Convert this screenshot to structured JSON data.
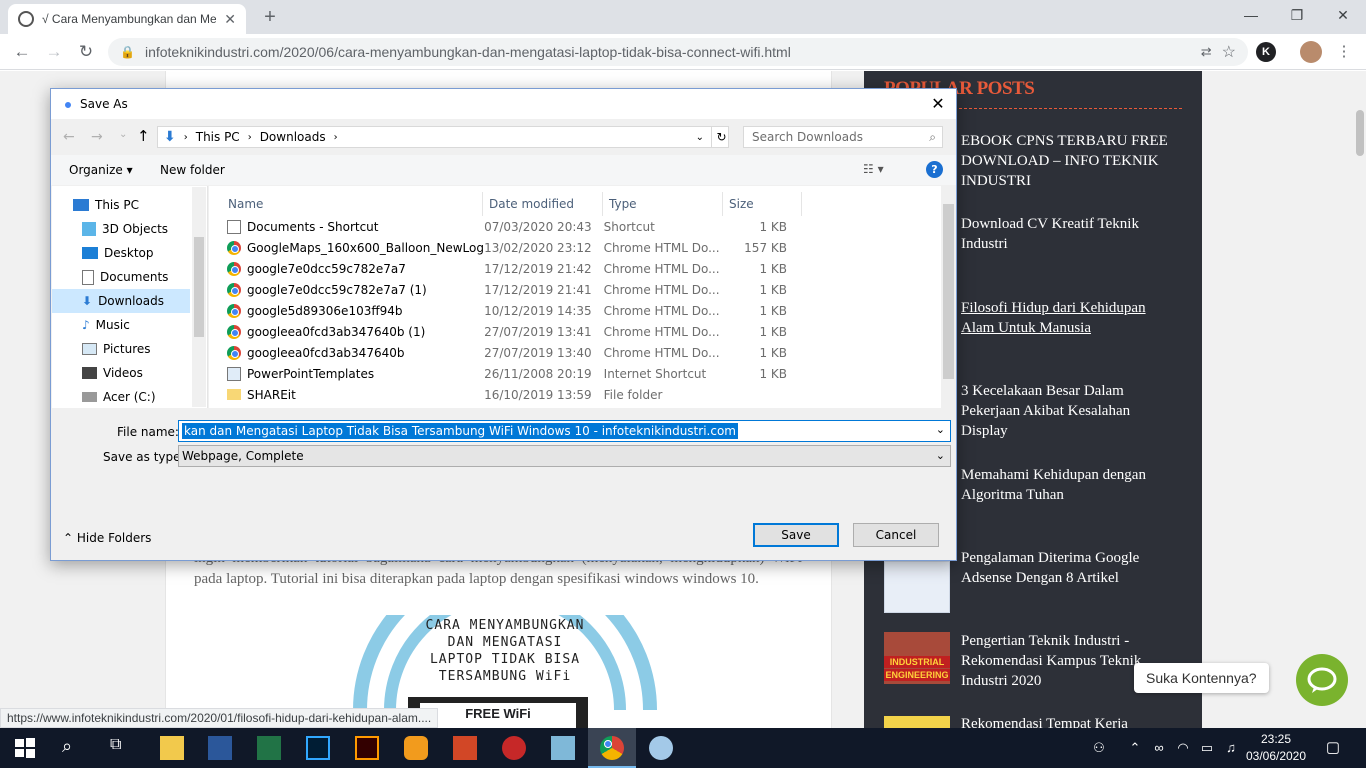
{
  "browser": {
    "tab_title": "√ Cara Menyambungkan dan Me",
    "new_tab_label": "+",
    "url": "infoteknikindustri.com/2020/06/cara-menyambungkan-dan-mengatasi-laptop-tidak-bisa-connect-wifi.html",
    "profile_initial": "K",
    "status_url": "https://www.infoteknikindustri.com/2020/01/filosofi-hidup-dari-kehidupan-alam...."
  },
  "article": {
    "text": "ingin memberikan tutorial bagaimana cara menyambungkan (menyalakan, menghidupkan) WiFi pada laptop. Tutorial ini bisa diterapkan pada laptop dengan spesifikasi windows windows 10.",
    "image_lines": [
      "CARA MENYAMBUNGKAN",
      "DAN MENGATASI",
      "LAPTOP TIDAK BISA",
      "TERSAMBUNG WiFi"
    ],
    "image_badge": "FREE WiFi"
  },
  "sidebar": {
    "title": "POPULAR POSTS",
    "posts": [
      "EBOOK CPNS TERBARU FREE DOWNLOAD – INFO TEKNIK INDUSTRI",
      "Download CV Kreatif Teknik Industri",
      "Filosofi Hidup dari Kehidupan Alam Untuk Manusia",
      "3 Kecelakaan Besar Dalam Pekerjaan Akibat Kesalahan Display",
      "Memahami Kehidupan dengan Algoritma Tuhan",
      "Pengalaman Diterima Google Adsense Dengan 8 Artikel",
      "Pengertian Teknik Industri - Rekomendasi Kampus Teknik Industri 2020",
      "Rekomendasi Tempat Kerja"
    ],
    "thumb_text": [
      "INDUSTRIAL",
      "ENGINEERING"
    ]
  },
  "chat": {
    "bubble": "Suka Kontennya?"
  },
  "dialog": {
    "title": "Save As",
    "path": [
      "This PC",
      "Downloads"
    ],
    "search_placeholder": "Search Downloads",
    "organize": "Organize ▾",
    "new_folder": "New folder",
    "help": "?",
    "nav": [
      "This PC",
      "3D Objects",
      "Desktop",
      "Documents",
      "Downloads",
      "Music",
      "Pictures",
      "Videos",
      "Acer (C:)"
    ],
    "columns": [
      "Name",
      "Date modified",
      "Type",
      "Size"
    ],
    "files": [
      {
        "name": "Documents - Shortcut",
        "date": "07/03/2020 20:43",
        "type": "Shortcut",
        "size": "1 KB",
        "icon": "shortcut-icon"
      },
      {
        "name": "GoogleMaps_160x600_Balloon_NewLogo",
        "date": "13/02/2020 23:12",
        "type": "Chrome HTML Do...",
        "size": "157 KB",
        "icon": "chrome-icon"
      },
      {
        "name": "google7e0dcc59c782e7a7",
        "date": "17/12/2019 21:42",
        "type": "Chrome HTML Do...",
        "size": "1 KB",
        "icon": "chrome-icon"
      },
      {
        "name": "google7e0dcc59c782e7a7 (1)",
        "date": "17/12/2019 21:41",
        "type": "Chrome HTML Do...",
        "size": "1 KB",
        "icon": "chrome-icon"
      },
      {
        "name": "google5d89306e103ff94b",
        "date": "10/12/2019 14:35",
        "type": "Chrome HTML Do...",
        "size": "1 KB",
        "icon": "chrome-icon"
      },
      {
        "name": "googleea0fcd3ab347640b (1)",
        "date": "27/07/2019 13:41",
        "type": "Chrome HTML Do...",
        "size": "1 KB",
        "icon": "chrome-icon"
      },
      {
        "name": "googleea0fcd3ab347640b",
        "date": "27/07/2019 13:40",
        "type": "Chrome HTML Do...",
        "size": "1 KB",
        "icon": "chrome-icon"
      },
      {
        "name": "PowerPointTemplates",
        "date": "26/11/2008 20:19",
        "type": "Internet Shortcut",
        "size": "1 KB",
        "icon": "internet-shortcut-icon"
      },
      {
        "name": "SHAREit",
        "date": "16/10/2019 13:59",
        "type": "File folder",
        "size": "",
        "icon": "folder-icon"
      }
    ],
    "file_name_label": "File name:",
    "file_name_value": "kan dan Mengatasi Laptop Tidak Bisa Tersambung WiFi Windows 10 - infoteknikindustri.com",
    "type_label": "Save as type:",
    "type_value": "Webpage, Complete",
    "hide_folders": "Hide Folders",
    "save": "Save",
    "cancel": "Cancel"
  },
  "taskbar": {
    "time": "23:25",
    "date": "03/06/2020"
  },
  "colors": {
    "accent": "#0078d7",
    "sidebar_bg": "#2d3038",
    "popular_title": "#e85a3a",
    "chat_green": "#7ab32e"
  }
}
